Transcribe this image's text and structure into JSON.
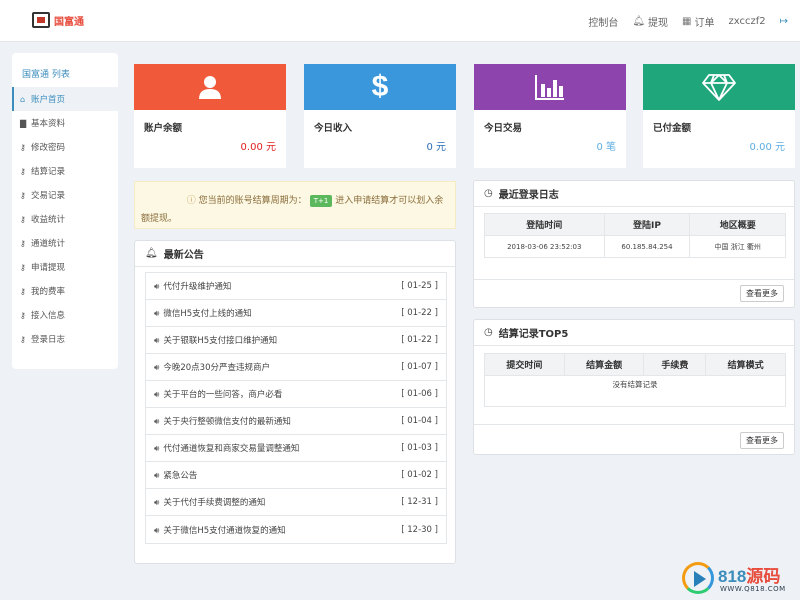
{
  "header": {
    "logo_text": "国富通",
    "nav": {
      "console": "控制台",
      "withdraw": "提现",
      "orders": "订单",
      "username": "zxcczf2"
    }
  },
  "sidebar": {
    "title": "国富通 列表",
    "items": [
      {
        "label": "账户首页",
        "icon": "home-icon"
      },
      {
        "label": "基本资料",
        "icon": "bar-chart-icon"
      },
      {
        "label": "修改密码",
        "icon": "key-icon"
      },
      {
        "label": "结算记录",
        "icon": "key-icon"
      },
      {
        "label": "交易记录",
        "icon": "key-icon"
      },
      {
        "label": "收益统计",
        "icon": "key-icon"
      },
      {
        "label": "通道统计",
        "icon": "key-icon"
      },
      {
        "label": "申请提现",
        "icon": "key-icon"
      },
      {
        "label": "我的费率",
        "icon": "key-icon"
      },
      {
        "label": "接入信息",
        "icon": "key-icon"
      },
      {
        "label": "登录日志",
        "icon": "key-icon"
      }
    ]
  },
  "cards": [
    {
      "label": "账户余额",
      "value": "0.00 元",
      "color": "#f05a3a",
      "value_color": "#e02020",
      "icon": "user-icon"
    },
    {
      "label": "今日收入",
      "value": "0 元",
      "color": "#3b97dc",
      "value_color": "#2a6db5",
      "icon": "dollar-icon"
    },
    {
      "label": "今日交易",
      "value": "0 笔",
      "color": "#8e44ad",
      "value_color": "#5dade2",
      "icon": "bar-chart-icon"
    },
    {
      "label": "已付金额",
      "value": "0.00 元",
      "color": "#1fa67a",
      "value_color": "#5dade2",
      "icon": "diamond-icon"
    }
  ],
  "notice": {
    "text_before": "您当前的账号结算周期为：",
    "badge": "T+1",
    "text_after": "进入申请结算才可以划入余额提现。"
  },
  "announcements": {
    "title": "最新公告",
    "items": [
      {
        "title": "代付升级维护通知",
        "date": "[ 01-25 ]"
      },
      {
        "title": "微信H5支付上线的通知",
        "date": "[ 01-22 ]"
      },
      {
        "title": "关于银联H5支付接口维护通知",
        "date": "[ 01-22 ]"
      },
      {
        "title": "今晚20点30分严查违规商户",
        "date": "[ 01-07 ]"
      },
      {
        "title": "关于平台的一些问答，商户必看",
        "date": "[ 01-06 ]"
      },
      {
        "title": "关于央行整顿微信支付的最新通知",
        "date": "[ 01-04 ]"
      },
      {
        "title": "代付通道恢复和商家交易量调整通知",
        "date": "[ 01-03 ]"
      },
      {
        "title": "紧急公告",
        "date": "[ 01-02 ]"
      },
      {
        "title": "关于代付手续费调整的通知",
        "date": "[ 12-31 ]"
      },
      {
        "title": "关于微信H5支付通道恢复的通知",
        "date": "[ 12-30 ]"
      }
    ]
  },
  "login_log": {
    "title": "最近登录日志",
    "columns": [
      "登陆时间",
      "登陆IP",
      "地区概要"
    ],
    "rows": [
      [
        "2018-03-06 23:52:03",
        "60.185.84.254",
        "中国 浙江 衢州"
      ]
    ],
    "more": "查看更多"
  },
  "settlement": {
    "title": "结算记录TOP5",
    "columns": [
      "提交时间",
      "结算金额",
      "手续费",
      "结算模式"
    ],
    "empty": "没有结算记录",
    "more": "查看更多"
  },
  "watermark": {
    "number": "818",
    "cn": "源码",
    "url": "WWW.Q818.COM"
  }
}
